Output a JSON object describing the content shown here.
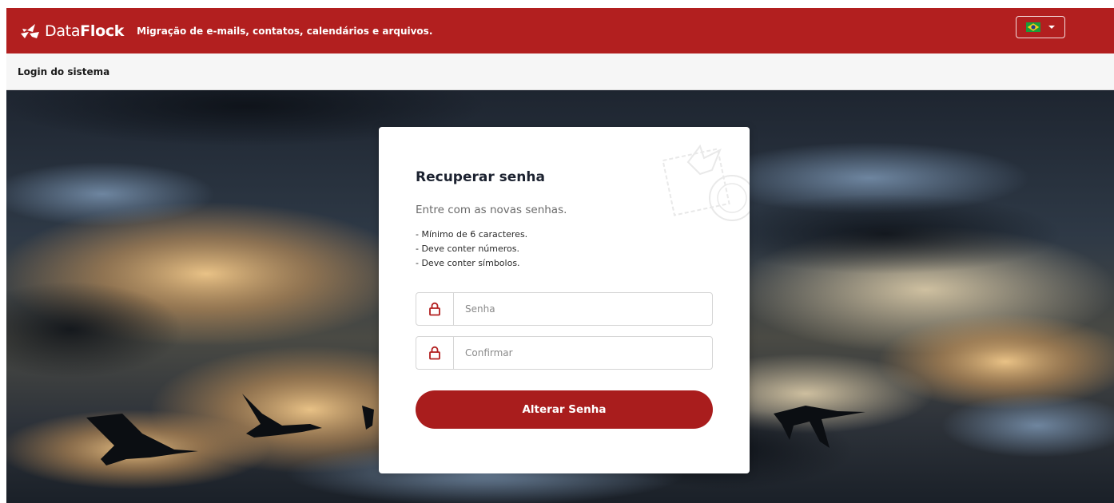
{
  "header": {
    "brand_light": "Data",
    "brand_bold": "Flock",
    "tagline": "Migração de e-mails, contatos, calendários e arquivos.",
    "language_icon": "brazil-flag-icon",
    "brand_color": "#b21f1f"
  },
  "subbar": {
    "title": "Login do sistema"
  },
  "card": {
    "title": "Recuperar senha",
    "subtitle": "Entre com as novas senhas.",
    "rules": [
      "- Mínimo de 6 caracteres.",
      "- Deve conter números.",
      "- Deve conter símbolos."
    ],
    "password_field": {
      "placeholder": "Senha",
      "value": "",
      "icon": "lock-icon"
    },
    "confirm_field": {
      "placeholder": "Confirmar",
      "value": "",
      "icon": "lock-icon"
    },
    "submit_label": "Alterar Senha",
    "button_color": "#a91d1d"
  },
  "background": {
    "description_icon": "sky-with-flying-swans-image"
  }
}
